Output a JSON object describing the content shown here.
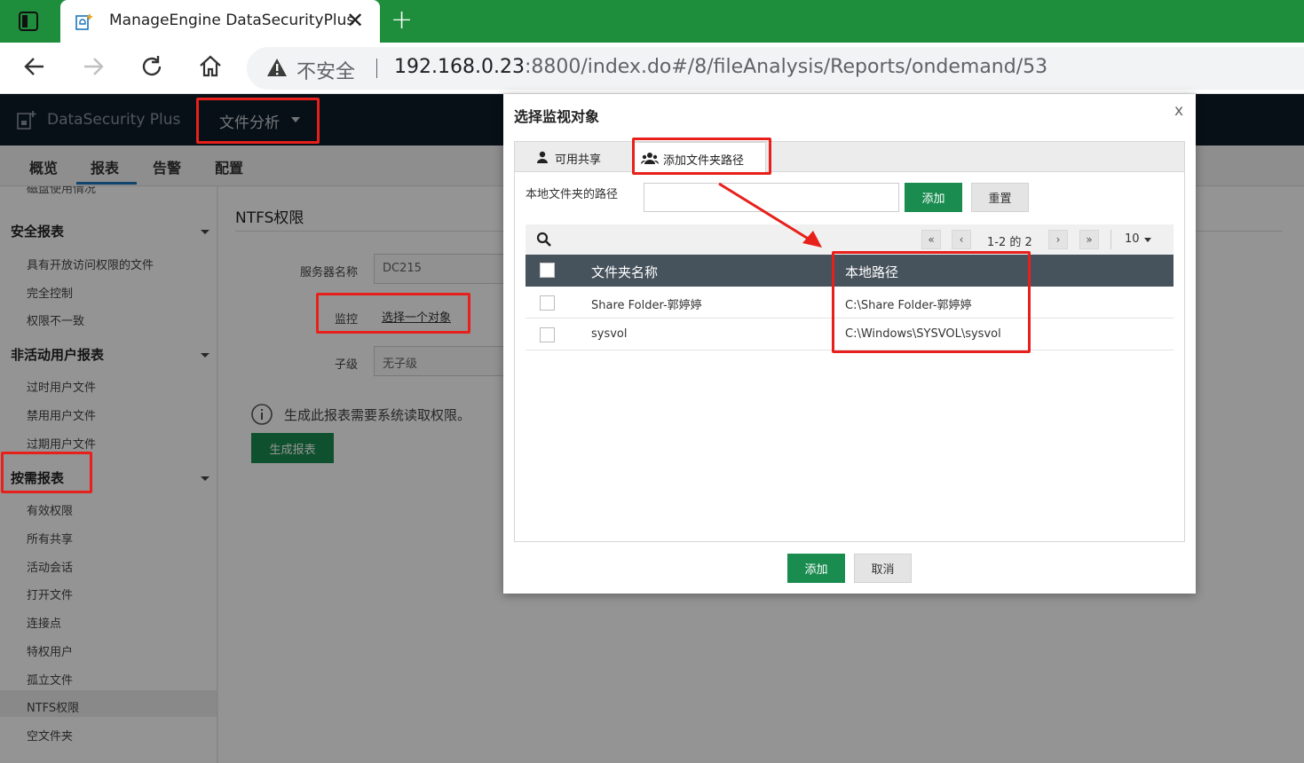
{
  "browser": {
    "tab_title": "ManageEngine DataSecurityPlus",
    "security_label": "不安全",
    "url_host": "192.168.0.23",
    "url_rest": ":8800/index.do#/8/fileAnalysis/Reports/ondemand/53"
  },
  "app": {
    "brand": "DataSecurity Plus",
    "module": "文件分析",
    "nav_tabs": [
      "概览",
      "报表",
      "告警",
      "配置"
    ],
    "active_nav": "报表"
  },
  "sidebar": {
    "cut_item": "磁盘使用情况",
    "sections": [
      {
        "title": "安全报表",
        "items": [
          "具有开放访问权限的文件",
          "完全控制",
          "权限不一致"
        ]
      },
      {
        "title": "非活动用户报表",
        "items": [
          "过时用户文件",
          "禁用用户文件",
          "过期用户文件"
        ]
      },
      {
        "title": "按需报表",
        "items": [
          "有效权限",
          "所有共享",
          "活动会话",
          "打开文件",
          "连接点",
          "特权用户",
          "孤立文件",
          "NTFS权限",
          "空文件夹"
        ]
      }
    ],
    "active_item": "NTFS权限"
  },
  "main": {
    "title": "NTFS权限",
    "server_label": "服务器名称",
    "server_value": "DC215",
    "monitor_label": "监控",
    "monitor_link": "选择一个对象",
    "sublevel_label": "子级",
    "sublevel_value": "无子级",
    "info_text": "生成此报表需要系统读取权限。",
    "generate_button": "生成报表"
  },
  "modal": {
    "title": "选择监视对象",
    "close": "x",
    "tabs": [
      "可用共享",
      "添加文件夹路径"
    ],
    "active_tab": "添加文件夹路径",
    "path_label": "本地文件夹的路径",
    "path_value": "",
    "add_button": "添加",
    "reset_button": "重置",
    "pagination": {
      "first": "«",
      "prev": "‹",
      "text": "1-2 的 2",
      "next": "›",
      "last": "»",
      "page_size": "10"
    },
    "columns": [
      "文件夹名称",
      "本地路径"
    ],
    "rows": [
      {
        "name": "Share Folder-郭婷婷",
        "path": "C:\\Share Folder-郭婷婷"
      },
      {
        "name": "sysvol",
        "path": "C:\\Windows\\SYSVOL\\sysvol"
      }
    ],
    "footer_add": "添加",
    "footer_cancel": "取消"
  },
  "colors": {
    "browser_accent": "#1f8e3c",
    "app_header": "#0e1d29",
    "primary_button": "#1a8c50",
    "grid_header": "#46525c",
    "annotation": "#e8201b"
  }
}
